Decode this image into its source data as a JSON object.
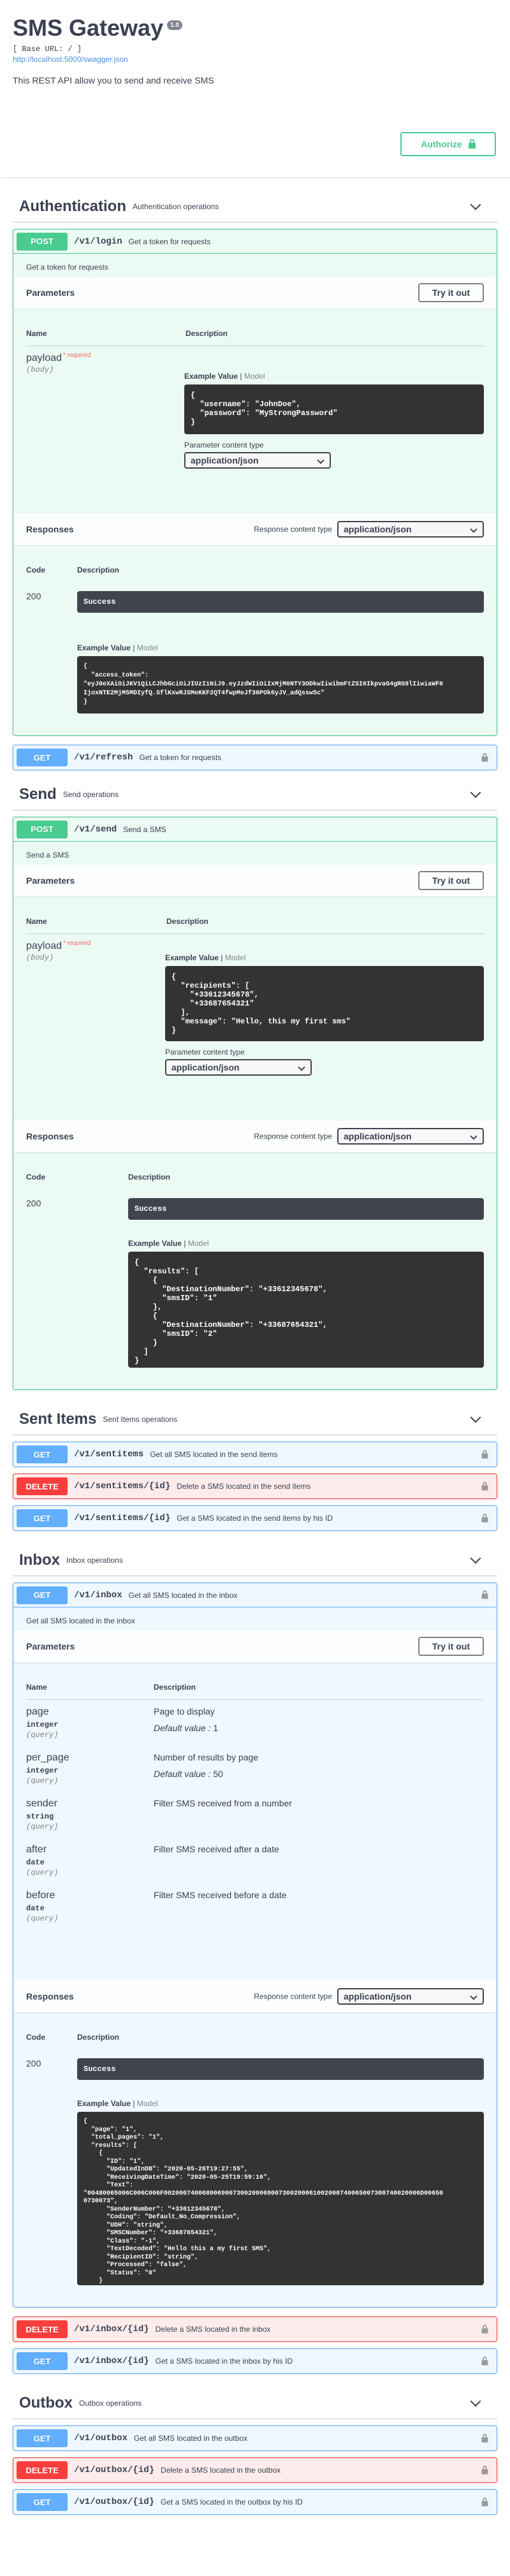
{
  "info": {
    "title": "SMS Gateway",
    "version": "1.0",
    "base_url": "[ Base URL: / ]",
    "spec_link": "http://localhost:5000/swagger.json",
    "description": "This REST API allow you to send and receive SMS"
  },
  "authorize_label": "Authorize",
  "common": {
    "parameters": "Parameters",
    "try": "Try it out",
    "responses": "Responses",
    "name_col": "Name",
    "desc_col": "Description",
    "code_col": "Code",
    "example_value": "Example Value",
    "model": "Model",
    "param_ct_label": "Parameter content type",
    "resp_ct_label": "Response content type",
    "json": "application/json",
    "success": "Success",
    "required": "* required",
    "body_in": "(body)",
    "default_label": "Default value"
  },
  "tags": {
    "auth": {
      "name": "Authentication",
      "desc": "Authentication operations"
    },
    "send": {
      "name": "Send",
      "desc": "Send operations"
    },
    "sent": {
      "name": "Sent Items",
      "desc": "Sent Items operations"
    },
    "inbox": {
      "name": "Inbox",
      "desc": "Inbox operations"
    },
    "outbox": {
      "name": "Outbox",
      "desc": "Outbox operations"
    }
  },
  "ops": {
    "login": {
      "method": "POST",
      "path": "/v1/login",
      "summary": "Get a token for requests",
      "description": "Get a token for requests",
      "param_name": "payload",
      "example": "{\n  \"username\": \"JohnDoe\",\n  \"password\": \"MyStrongPassword\"\n}",
      "resp_code": "200",
      "resp_example": "{\n  \"access_token\":\n\"eyJ0eXAiOiJKV1QiLCJhbGciOiJIUzI1NiJ9.eyJzdWIiOiIxMjM0NTY3ODkwIiwibmFtZSI6IkpvaG4gRG9lIiwiaWF0\nIjoxNTE2MjM5MDIyfQ.SflKxwRJSMeKKF2QT4fwpMeJf36POk6yJV_adQssw5c\"\n}"
    },
    "refresh": {
      "method": "GET",
      "path": "/v1/refresh",
      "summary": "Get a token for requests"
    },
    "send": {
      "method": "POST",
      "path": "/v1/send",
      "summary": "Send a SMS",
      "description": "Send a SMS",
      "param_name": "payload",
      "example": "{\n  \"recipients\": [\n    \"+33612345678\",\n    \"+33687654321\"\n  ],\n  \"message\": \"Hello, this my first sms\"\n}",
      "resp_code": "200",
      "resp_example": "{\n  \"results\": [\n    {\n      \"DestinationNumber\": \"+33612345678\",\n      \"smsID\": \"1\"\n    },\n    {\n      \"DestinationNumber\": \"+33687654321\",\n      \"smsID\": \"2\"\n    }\n  ]\n}"
    },
    "sentitems_get": {
      "method": "GET",
      "path": "/v1/sentitems",
      "summary": "Get all SMS located in the send items"
    },
    "sentitems_delete": {
      "method": "DELETE",
      "path": "/v1/sentitems/{id}",
      "summary": "Delete a SMS located in the send items"
    },
    "sentitems_get_id": {
      "method": "GET",
      "path": "/v1/sentitems/{id}",
      "summary": "Get a SMS located in the send items by his ID"
    },
    "inbox": {
      "method": "GET",
      "path": "/v1/inbox",
      "summary": "Get all SMS located in the inbox",
      "description": "Get all SMS located in the inbox",
      "resp_code": "200",
      "params": [
        {
          "name": "page",
          "type": "integer",
          "in": "(query)",
          "desc": "Page to display",
          "default": "1"
        },
        {
          "name": "per_page",
          "type": "integer",
          "in": "(query)",
          "desc": "Number of results by page",
          "default": "50"
        },
        {
          "name": "sender",
          "type": "string",
          "in": "(query)",
          "desc": "Filter SMS received from a number"
        },
        {
          "name": "after",
          "type": "date",
          "in": "(query)",
          "desc": "Filter SMS received after a date"
        },
        {
          "name": "before",
          "type": "date",
          "in": "(query)",
          "desc": "Filter SMS received before a date"
        }
      ],
      "resp_example": "{\n  \"page\": \"1\",\n  \"total_pages\": \"1\",\n  \"results\": [\n    {\n      \"ID\": \"1\",\n      \"UpdatedInDB\": \"2020-05-26T19:27:55\",\n      \"ReceivingDateTime\": \"2020-05-25T19:59:16\",\n      \"Text\":\n\"00480065006C006C006F0020007400680069007300200069007300200061002000740065007300740020006D00650\n0730073\",\n      \"SenderNumber\": \"+33612345678\",\n      \"Coding\": \"Default_No_Compression\",\n      \"UDH\": \"string\",\n      \"SMSCNumber\": \"+33687654321\",\n      \"Class\": \"-1\",\n      \"TextDecoded\": \"Hello this a my first SMS\",\n      \"RecipientID\": \"string\",\n      \"Processed\": \"false\",\n      \"Status\": \"0\"\n    }\n  ]\n}"
    },
    "inbox_delete": {
      "method": "DELETE",
      "path": "/v1/inbox/{id}",
      "summary": "Delete a SMS located in the inbox"
    },
    "inbox_get_id": {
      "method": "GET",
      "path": "/v1/inbox/{id}",
      "summary": "Get a SMS located in the inbox by his ID"
    },
    "outbox_get": {
      "method": "GET",
      "path": "/v1/outbox",
      "summary": "Get all SMS located in the outbox"
    },
    "outbox_delete": {
      "method": "DELETE",
      "path": "/v1/outbox/{id}",
      "summary": "Delete a SMS located in the outbox"
    },
    "outbox_get_id": {
      "method": "GET",
      "path": "/v1/outbox/{id}",
      "summary": "Get a SMS located in the outbox by his ID"
    }
  }
}
